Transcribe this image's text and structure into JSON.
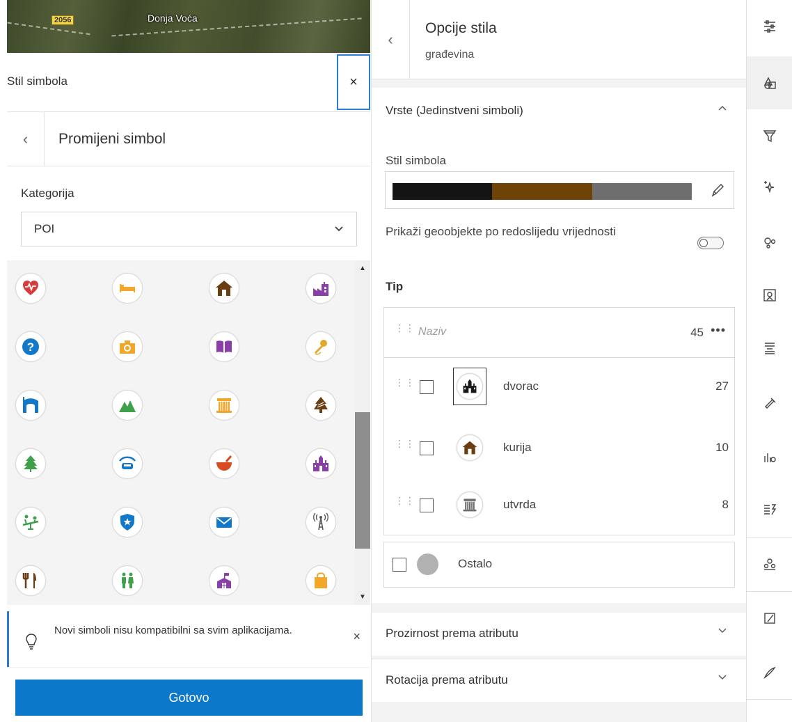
{
  "map": {
    "road_badge": "2056",
    "place_label": "Donja Voća"
  },
  "left_panel": {
    "title": "Stil simbola",
    "close_icon": "×",
    "subheader": {
      "back_icon": "‹",
      "title": "Promijeni simbol"
    },
    "category": {
      "label": "Kategorija",
      "value": "POI"
    },
    "symbols": [
      {
        "name": "heart",
        "color": "#d93b3b"
      },
      {
        "name": "hotel",
        "color": "#f2a62a"
      },
      {
        "name": "house",
        "color": "#6b3d12"
      },
      {
        "name": "factory",
        "color": "#8a3fa8"
      },
      {
        "name": "help",
        "color": "#1478c8"
      },
      {
        "name": "camera",
        "color": "#f2a62a"
      },
      {
        "name": "book",
        "color": "#8a3fa8"
      },
      {
        "name": "microphone",
        "color": "#e0a92a"
      },
      {
        "name": "tent",
        "color": "#1478c8"
      },
      {
        "name": "mountain",
        "color": "#3fa04a"
      },
      {
        "name": "column",
        "color": "#f2a62a"
      },
      {
        "name": "cone-tree",
        "color": "#6b3d12"
      },
      {
        "name": "tree",
        "color": "#3fa04a"
      },
      {
        "name": "car-shelter",
        "color": "#1478c8"
      },
      {
        "name": "mortar",
        "color": "#d94a1f"
      },
      {
        "name": "castle",
        "color": "#8a3fa8"
      },
      {
        "name": "playground",
        "color": "#3fa04a"
      },
      {
        "name": "police",
        "color": "#1478c8"
      },
      {
        "name": "mail",
        "color": "#1478c8"
      },
      {
        "name": "radio-tower",
        "color": "#555555"
      },
      {
        "name": "restaurant",
        "color": "#6b3d12"
      },
      {
        "name": "restroom",
        "color": "#3fa04a"
      },
      {
        "name": "school",
        "color": "#8a3fa8"
      },
      {
        "name": "shopping",
        "color": "#f2a62a"
      }
    ],
    "notice": {
      "text": "Novi simboli nisu kompatibilni sa svim aplikacijama.",
      "close_icon": "×"
    },
    "done_button": "Gotovo"
  },
  "mid_panel": {
    "header": {
      "back_icon": "‹",
      "title": "Opcije stila",
      "subtitle": "građevina"
    },
    "section": {
      "title": "Vrste (Jedinstveni simboli)",
      "style_label": "Stil simbola",
      "ramp_colors": [
        "#141414",
        "#6e4308",
        "#6e6e6e"
      ],
      "order_label": "Prikaži geoobjekte po redoslijedu vrijednosti",
      "order_toggle": false,
      "type_label": "Tip",
      "table": {
        "field_placeholder": "Naziv",
        "total": "45",
        "more_icon": "•••",
        "rows": [
          {
            "label": "dvorac",
            "count": "27",
            "symbol": "castle",
            "color": "#1a1a1a",
            "selected": true
          },
          {
            "label": "kurija",
            "count": "10",
            "symbol": "house",
            "color": "#6b3d12",
            "selected": false
          },
          {
            "label": "utvrda",
            "count": "8",
            "symbol": "column",
            "color": "#6e6e6e",
            "selected": false
          }
        ]
      },
      "other": {
        "label": "Ostalo",
        "color": "#b1b1b1"
      }
    },
    "accordions": [
      {
        "label": "Prozirnost prema atributu"
      },
      {
        "label": "Rotacija prema atributu"
      }
    ]
  },
  "rail": {
    "items": [
      "properties-icon",
      "styles-icon",
      "filter-icon",
      "effects-icon",
      "clustering-icon",
      "popup-icon",
      "labels-icon",
      "sketch-icon",
      "charts-icon",
      "form-icon",
      "relations-icon",
      "edit-icon",
      "draw-icon"
    ]
  }
}
